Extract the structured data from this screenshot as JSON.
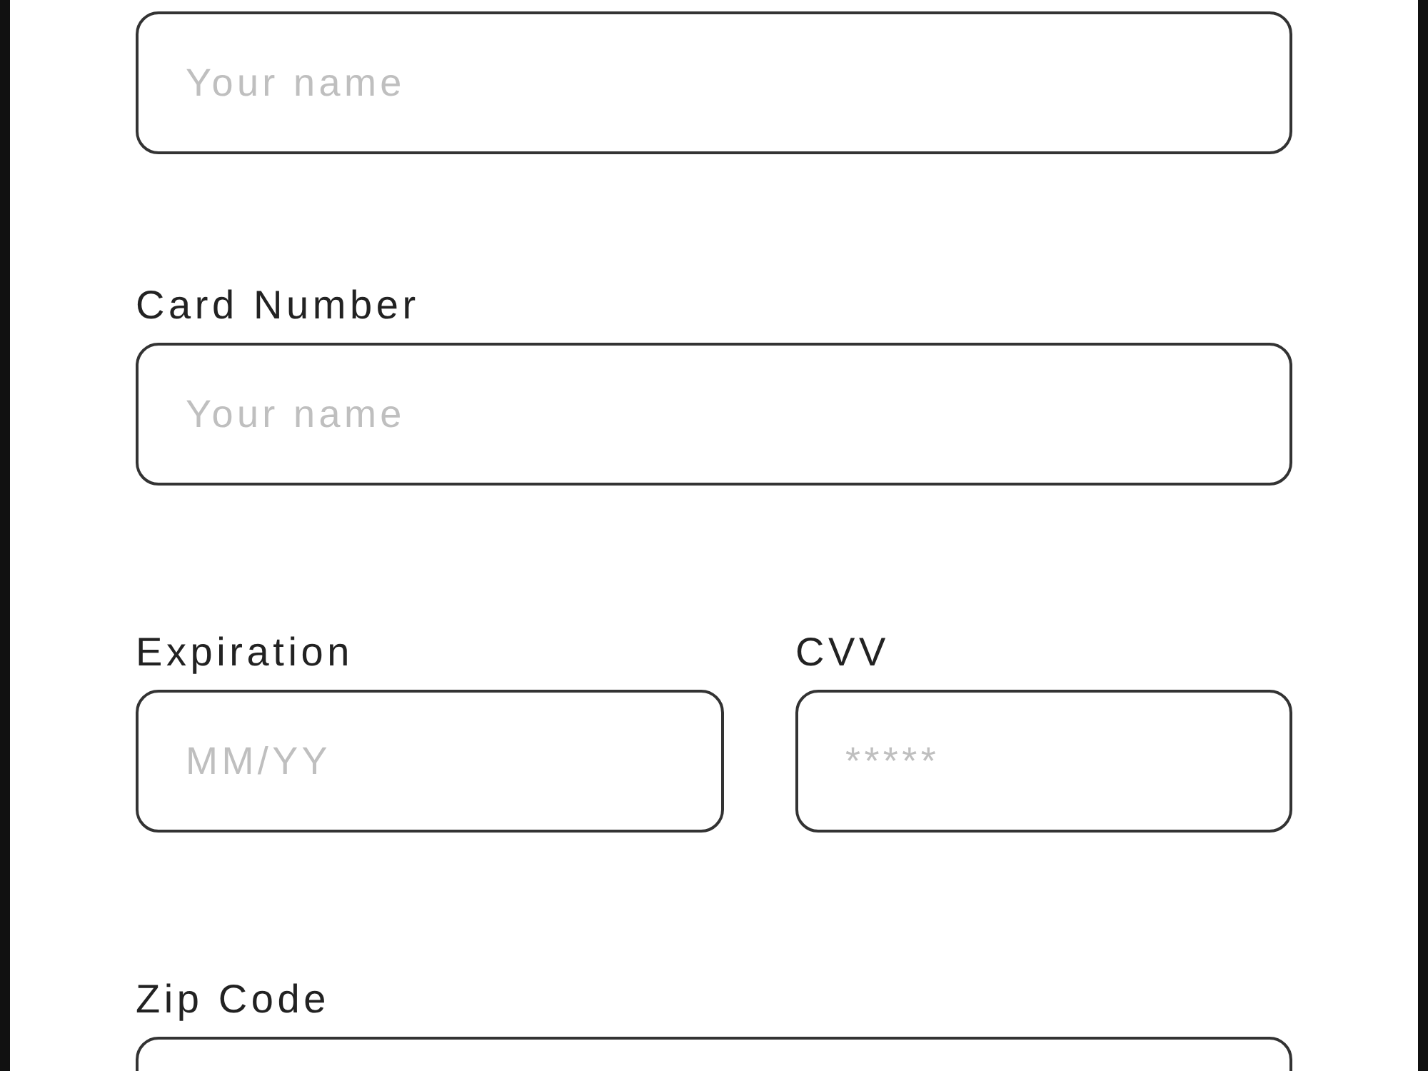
{
  "form": {
    "rows": [
      {
        "fields": [
          {
            "placeholder": "Your name"
          }
        ]
      },
      {
        "fields": [
          {
            "label": "Card Number",
            "placeholder": "Your name"
          }
        ]
      },
      {
        "fields": [
          {
            "label": "Expiration",
            "placeholder": "MM/YY"
          },
          {
            "label": "CVV",
            "placeholder": "*****"
          }
        ]
      },
      {
        "fields": [
          {
            "label": "Zip Code"
          }
        ]
      }
    ]
  }
}
